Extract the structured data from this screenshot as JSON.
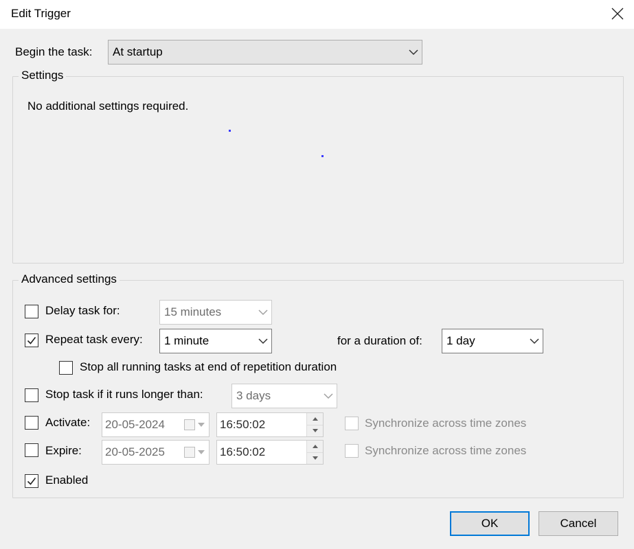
{
  "window": {
    "title": "Edit Trigger"
  },
  "begin": {
    "label": "Begin the task:",
    "value": "At startup"
  },
  "settings": {
    "group_label": "Settings",
    "message": "No additional settings required."
  },
  "advanced": {
    "group_label": "Advanced settings",
    "delay": {
      "label": "Delay task for:",
      "checked": false,
      "value": "15 minutes"
    },
    "repeat": {
      "label": "Repeat task every:",
      "checked": true,
      "value": "1 minute",
      "duration_label": "for a duration of:",
      "duration_value": "1 day"
    },
    "stop_running": {
      "label": "Stop all running tasks at end of repetition duration",
      "checked": false
    },
    "stop_longer": {
      "label": "Stop task if it runs longer than:",
      "checked": false,
      "value": "3 days"
    },
    "activate": {
      "label": "Activate:",
      "checked": false,
      "date": "20-05-2024",
      "time": "16:50:02",
      "sync_label": "Synchronize across time zones"
    },
    "expire": {
      "label": "Expire:",
      "checked": false,
      "date": "20-05-2025",
      "time": "16:50:02",
      "sync_label": "Synchronize across time zones"
    },
    "enabled": {
      "label": "Enabled",
      "checked": true
    }
  },
  "buttons": {
    "ok": "OK",
    "cancel": "Cancel"
  },
  "icons": {
    "close": "close-icon",
    "dropdown": "chevron-down-icon",
    "check": "checkmark-icon",
    "calendar": "calendar-icon",
    "spin_up": "spin-up-icon",
    "spin_down": "spin-down-icon"
  },
  "colors": {
    "window_bg": "#f0f0f0",
    "titlebar_bg": "#ffffff",
    "accent": "#0078d7",
    "disabled_text": "#8a8a8a"
  }
}
